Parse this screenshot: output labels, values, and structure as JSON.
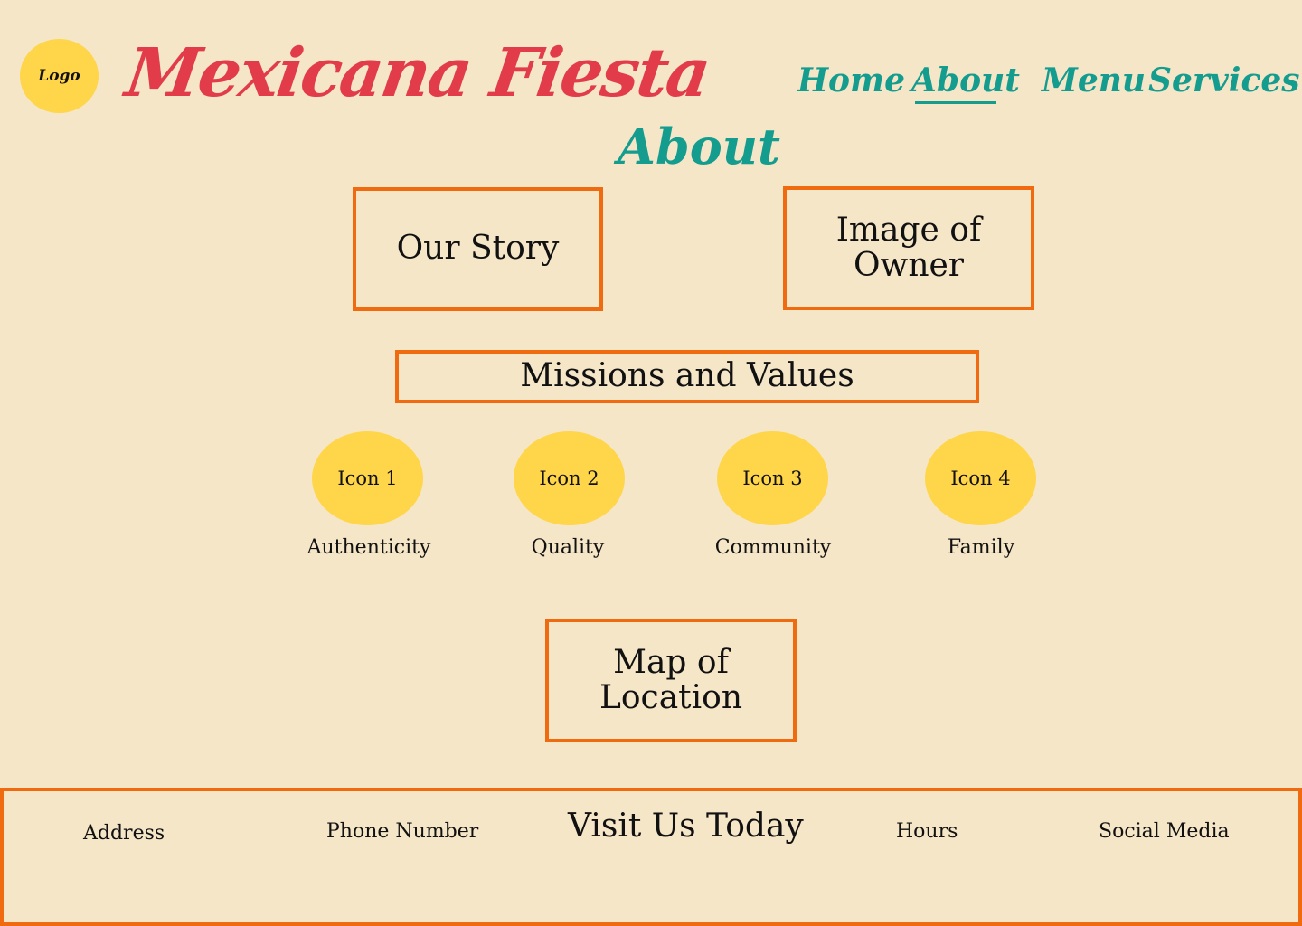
{
  "header": {
    "logo_label": "Logo",
    "brand_name": "Mexicana Fiesta",
    "nav": [
      {
        "label": "Home"
      },
      {
        "label": "About",
        "active": true
      },
      {
        "label": "Menu"
      },
      {
        "label": "Services"
      }
    ]
  },
  "page_title": "About",
  "sections": {
    "our_story": "Our Story",
    "owner_image_line1": "Image of",
    "owner_image_line2": "Owner",
    "missions": "Missions and Values",
    "map_line1": "Map of",
    "map_line2": "Location"
  },
  "values": [
    {
      "icon": "Icon 1",
      "label": "Authenticity"
    },
    {
      "icon": "Icon 2",
      "label": "Quality"
    },
    {
      "icon": "Icon 3",
      "label": "Community"
    },
    {
      "icon": "Icon 4",
      "label": "Family"
    }
  ],
  "footer": {
    "address": "Address",
    "phone": "Phone Number",
    "title": "Visit Us Today",
    "hours": "Hours",
    "social": "Social Media"
  },
  "colors": {
    "background": "#f5e6c8",
    "brand": "#e23b4a",
    "nav": "#149c8f",
    "border": "#f06a0f",
    "circle": "#ffd54a"
  }
}
